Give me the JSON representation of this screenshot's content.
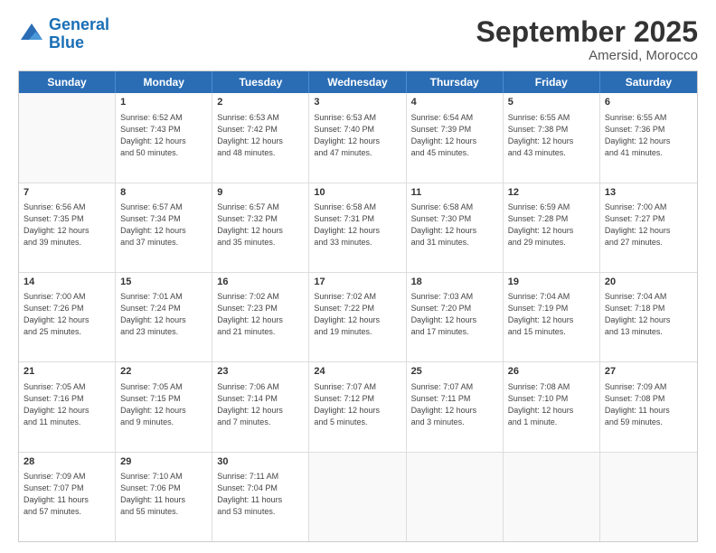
{
  "header": {
    "logo_line1": "General",
    "logo_line2": "Blue",
    "title": "September 2025",
    "subtitle": "Amersid, Morocco"
  },
  "days": [
    "Sunday",
    "Monday",
    "Tuesday",
    "Wednesday",
    "Thursday",
    "Friday",
    "Saturday"
  ],
  "weeks": [
    [
      {
        "day": "",
        "content": ""
      },
      {
        "day": "1",
        "content": "Sunrise: 6:52 AM\nSunset: 7:43 PM\nDaylight: 12 hours\nand 50 minutes."
      },
      {
        "day": "2",
        "content": "Sunrise: 6:53 AM\nSunset: 7:42 PM\nDaylight: 12 hours\nand 48 minutes."
      },
      {
        "day": "3",
        "content": "Sunrise: 6:53 AM\nSunset: 7:40 PM\nDaylight: 12 hours\nand 47 minutes."
      },
      {
        "day": "4",
        "content": "Sunrise: 6:54 AM\nSunset: 7:39 PM\nDaylight: 12 hours\nand 45 minutes."
      },
      {
        "day": "5",
        "content": "Sunrise: 6:55 AM\nSunset: 7:38 PM\nDaylight: 12 hours\nand 43 minutes."
      },
      {
        "day": "6",
        "content": "Sunrise: 6:55 AM\nSunset: 7:36 PM\nDaylight: 12 hours\nand 41 minutes."
      }
    ],
    [
      {
        "day": "7",
        "content": "Sunrise: 6:56 AM\nSunset: 7:35 PM\nDaylight: 12 hours\nand 39 minutes."
      },
      {
        "day": "8",
        "content": "Sunrise: 6:57 AM\nSunset: 7:34 PM\nDaylight: 12 hours\nand 37 minutes."
      },
      {
        "day": "9",
        "content": "Sunrise: 6:57 AM\nSunset: 7:32 PM\nDaylight: 12 hours\nand 35 minutes."
      },
      {
        "day": "10",
        "content": "Sunrise: 6:58 AM\nSunset: 7:31 PM\nDaylight: 12 hours\nand 33 minutes."
      },
      {
        "day": "11",
        "content": "Sunrise: 6:58 AM\nSunset: 7:30 PM\nDaylight: 12 hours\nand 31 minutes."
      },
      {
        "day": "12",
        "content": "Sunrise: 6:59 AM\nSunset: 7:28 PM\nDaylight: 12 hours\nand 29 minutes."
      },
      {
        "day": "13",
        "content": "Sunrise: 7:00 AM\nSunset: 7:27 PM\nDaylight: 12 hours\nand 27 minutes."
      }
    ],
    [
      {
        "day": "14",
        "content": "Sunrise: 7:00 AM\nSunset: 7:26 PM\nDaylight: 12 hours\nand 25 minutes."
      },
      {
        "day": "15",
        "content": "Sunrise: 7:01 AM\nSunset: 7:24 PM\nDaylight: 12 hours\nand 23 minutes."
      },
      {
        "day": "16",
        "content": "Sunrise: 7:02 AM\nSunset: 7:23 PM\nDaylight: 12 hours\nand 21 minutes."
      },
      {
        "day": "17",
        "content": "Sunrise: 7:02 AM\nSunset: 7:22 PM\nDaylight: 12 hours\nand 19 minutes."
      },
      {
        "day": "18",
        "content": "Sunrise: 7:03 AM\nSunset: 7:20 PM\nDaylight: 12 hours\nand 17 minutes."
      },
      {
        "day": "19",
        "content": "Sunrise: 7:04 AM\nSunset: 7:19 PM\nDaylight: 12 hours\nand 15 minutes."
      },
      {
        "day": "20",
        "content": "Sunrise: 7:04 AM\nSunset: 7:18 PM\nDaylight: 12 hours\nand 13 minutes."
      }
    ],
    [
      {
        "day": "21",
        "content": "Sunrise: 7:05 AM\nSunset: 7:16 PM\nDaylight: 12 hours\nand 11 minutes."
      },
      {
        "day": "22",
        "content": "Sunrise: 7:05 AM\nSunset: 7:15 PM\nDaylight: 12 hours\nand 9 minutes."
      },
      {
        "day": "23",
        "content": "Sunrise: 7:06 AM\nSunset: 7:14 PM\nDaylight: 12 hours\nand 7 minutes."
      },
      {
        "day": "24",
        "content": "Sunrise: 7:07 AM\nSunset: 7:12 PM\nDaylight: 12 hours\nand 5 minutes."
      },
      {
        "day": "25",
        "content": "Sunrise: 7:07 AM\nSunset: 7:11 PM\nDaylight: 12 hours\nand 3 minutes."
      },
      {
        "day": "26",
        "content": "Sunrise: 7:08 AM\nSunset: 7:10 PM\nDaylight: 12 hours\nand 1 minute."
      },
      {
        "day": "27",
        "content": "Sunrise: 7:09 AM\nSunset: 7:08 PM\nDaylight: 11 hours\nand 59 minutes."
      }
    ],
    [
      {
        "day": "28",
        "content": "Sunrise: 7:09 AM\nSunset: 7:07 PM\nDaylight: 11 hours\nand 57 minutes."
      },
      {
        "day": "29",
        "content": "Sunrise: 7:10 AM\nSunset: 7:06 PM\nDaylight: 11 hours\nand 55 minutes."
      },
      {
        "day": "30",
        "content": "Sunrise: 7:11 AM\nSunset: 7:04 PM\nDaylight: 11 hours\nand 53 minutes."
      },
      {
        "day": "",
        "content": ""
      },
      {
        "day": "",
        "content": ""
      },
      {
        "day": "",
        "content": ""
      },
      {
        "day": "",
        "content": ""
      }
    ]
  ]
}
